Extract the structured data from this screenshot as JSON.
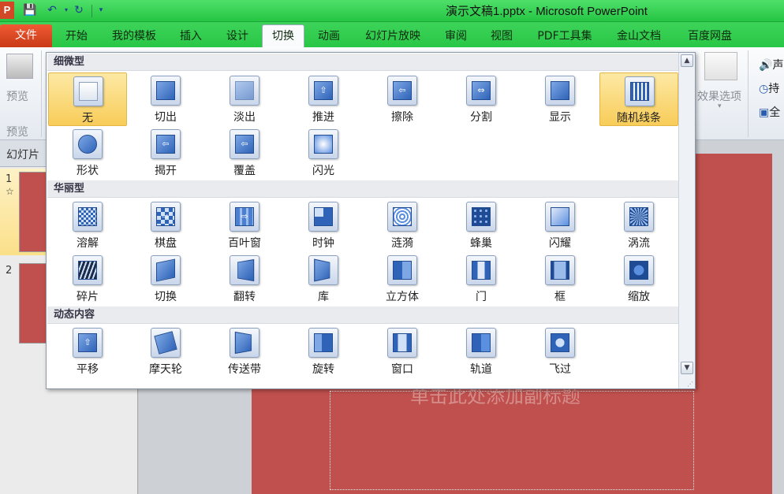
{
  "titlebar": {
    "app_icon": "P",
    "title": "演示文稿1.pptx - Microsoft PowerPoint"
  },
  "tabs": {
    "file": "文件",
    "items": [
      "开始",
      "我的模板",
      "插入",
      "设计",
      "切换",
      "动画",
      "幻灯片放映",
      "审阅",
      "视图",
      "PDF工具集",
      "金山文档",
      "百度网盘"
    ],
    "active": "切换"
  },
  "ribbon": {
    "preview_button": "预览",
    "preview_group": "预览",
    "effect_options": "效果选项",
    "sound": "声",
    "duration": "持",
    "apply_all": "全"
  },
  "gallery": {
    "sections": [
      {
        "title": "细微型",
        "items": [
          "无",
          "切出",
          "淡出",
          "推进",
          "擦除",
          "分割",
          "显示",
          "随机线条",
          "形状",
          "揭开",
          "覆盖",
          "闪光"
        ]
      },
      {
        "title": "华丽型",
        "items": [
          "溶解",
          "棋盘",
          "百叶窗",
          "时钟",
          "涟漪",
          "蜂巢",
          "闪耀",
          "涡流",
          "碎片",
          "切换",
          "翻转",
          "库",
          "立方体",
          "门",
          "框",
          "缩放"
        ]
      },
      {
        "title": "动态内容",
        "items": [
          "平移",
          "摩天轮",
          "传送带",
          "旋转",
          "窗口",
          "轨道",
          "飞过"
        ]
      }
    ],
    "selected": "无",
    "hover": "随机线条"
  },
  "sidebar": {
    "tab_label": "幻灯片",
    "slides": [
      {
        "number": "1",
        "star": "☆"
      },
      {
        "number": "2"
      }
    ]
  },
  "slide": {
    "subtitle_placeholder": "单击此处添加副标题"
  },
  "colors": {
    "titlebar": "#2ac846",
    "slide": "#c0504d",
    "file_tab": "#d84b24"
  }
}
